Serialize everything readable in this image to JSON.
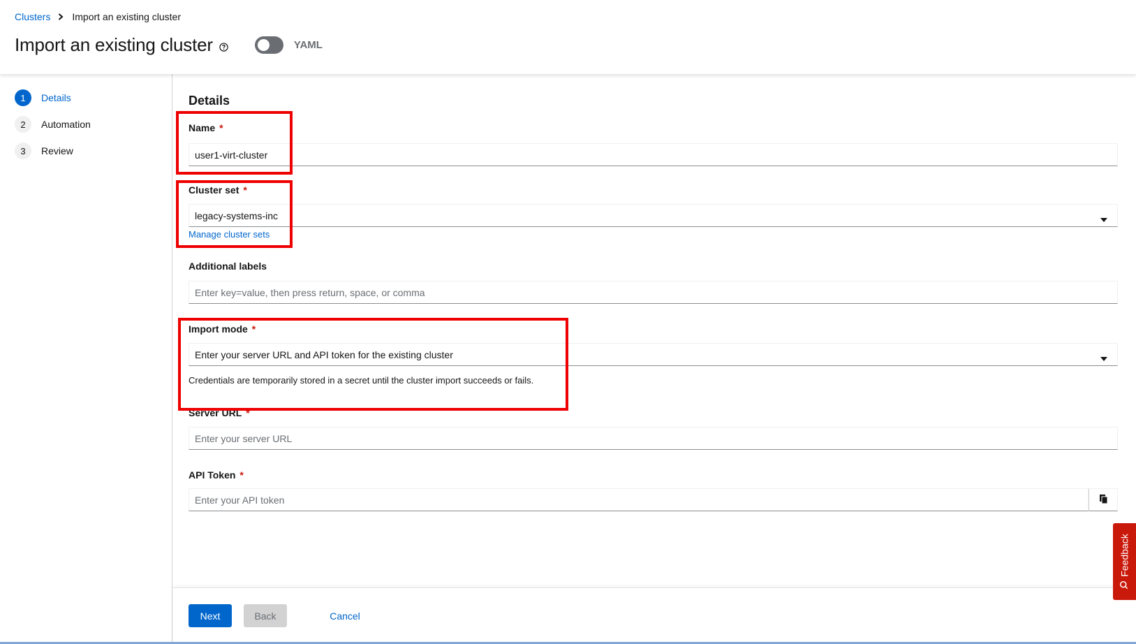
{
  "breadcrumb": {
    "root": "Clusters",
    "current": "Import an existing cluster"
  },
  "header": {
    "title": "Import an existing cluster",
    "yaml_label": "YAML",
    "yaml_enabled": false
  },
  "wizard_nav": {
    "steps": [
      {
        "number": "1",
        "label": "Details",
        "current": true
      },
      {
        "number": "2",
        "label": "Automation",
        "current": false
      },
      {
        "number": "3",
        "label": "Review",
        "current": false
      }
    ]
  },
  "form": {
    "section_title": "Details",
    "required_marker": "*",
    "name": {
      "label": "Name",
      "value": "user1-virt-cluster"
    },
    "cluster_set": {
      "label": "Cluster set",
      "value": "legacy-systems-inc",
      "link": "Manage cluster sets"
    },
    "additional_labels": {
      "label": "Additional labels",
      "placeholder": "Enter key=value, then press return, space, or comma"
    },
    "import_mode": {
      "label": "Import mode",
      "value": "Enter your server URL and API token for the existing cluster",
      "helper": "Credentials are temporarily stored in a secret until the cluster import succeeds or fails."
    },
    "server_url": {
      "label": "Server URL",
      "placeholder": "Enter your server URL"
    },
    "api_token": {
      "label": "API Token",
      "placeholder": "Enter your API token"
    }
  },
  "footer": {
    "next": "Next",
    "back": "Back",
    "cancel": "Cancel"
  },
  "feedback": {
    "label": "Feedback"
  },
  "colors": {
    "accent": "#0066cc",
    "highlight": "#ee0000",
    "feedback": "#c9190b"
  }
}
